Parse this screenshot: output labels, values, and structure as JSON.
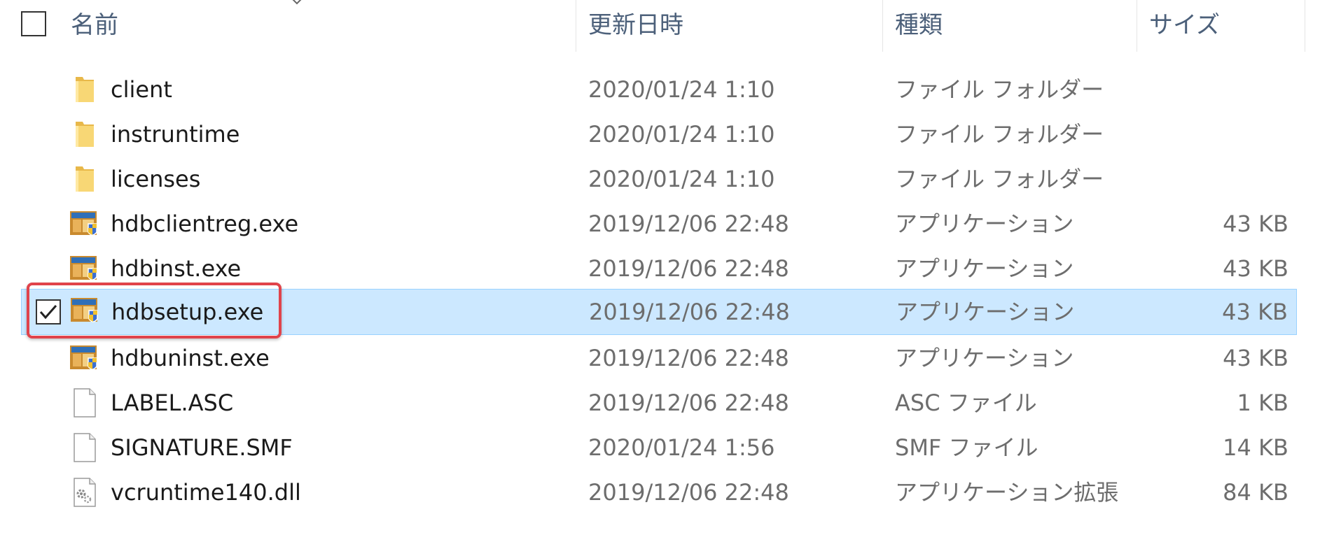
{
  "header": {
    "columns": {
      "name": "名前",
      "date": "更新日時",
      "type": "種類",
      "size": "サイズ"
    }
  },
  "files": [
    {
      "name": "client",
      "date": "2020/01/24 1:10",
      "type": "ファイル フォルダー",
      "size": "",
      "icon": "folder-icon"
    },
    {
      "name": "instruntime",
      "date": "2020/01/24 1:10",
      "type": "ファイル フォルダー",
      "size": "",
      "icon": "folder-icon"
    },
    {
      "name": "licenses",
      "date": "2020/01/24 1:10",
      "type": "ファイル フォルダー",
      "size": "",
      "icon": "folder-icon"
    },
    {
      "name": "hdbclientreg.exe",
      "date": "2019/12/06 22:48",
      "type": "アプリケーション",
      "size": "43 KB",
      "icon": "installer-exe-icon"
    },
    {
      "name": "hdbinst.exe",
      "date": "2019/12/06 22:48",
      "type": "アプリケーション",
      "size": "43 KB",
      "icon": "installer-exe-icon"
    },
    {
      "name": "hdbsetup.exe",
      "date": "2019/12/06 22:48",
      "type": "アプリケーション",
      "size": "43 KB",
      "icon": "installer-exe-icon",
      "selected": true
    },
    {
      "name": "hdbuninst.exe",
      "date": "2019/12/06 22:48",
      "type": "アプリケーション",
      "size": "43 KB",
      "icon": "installer-exe-icon"
    },
    {
      "name": "LABEL.ASC",
      "date": "2019/12/06 22:48",
      "type": "ASC ファイル",
      "size": "1 KB",
      "icon": "blank-file-icon"
    },
    {
      "name": "SIGNATURE.SMF",
      "date": "2020/01/24 1:56",
      "type": "SMF ファイル",
      "size": "14 KB",
      "icon": "blank-file-icon"
    },
    {
      "name": "vcruntime140.dll",
      "date": "2019/12/06 22:48",
      "type": "アプリケーション拡張",
      "size": "84 KB",
      "icon": "dll-gear-icon"
    }
  ],
  "colors": {
    "selection": "#cce8ff",
    "selection_border": "#99d1ff",
    "highlight_frame": "#e0434b",
    "header_text": "#4c607a"
  }
}
